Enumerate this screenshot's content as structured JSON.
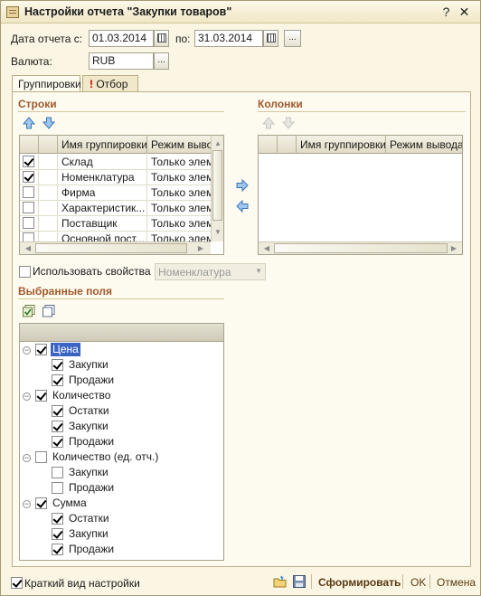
{
  "window": {
    "title": "Настройки отчета \"Закупки товаров\"",
    "help_glyph": "?",
    "close_glyph": "✕"
  },
  "header": {
    "date_label": "Дата отчета с:",
    "date_from": "01.03.2014",
    "to_label": "по:",
    "date_to": "31.03.2014",
    "period_button": "...",
    "currency_label": "Валюта:",
    "currency": "RUB",
    "currency_button": "..."
  },
  "tabs": [
    {
      "label": "Группировки",
      "active": true
    },
    {
      "label": "Отбор",
      "active": false
    }
  ],
  "rows_section": {
    "title": "Строки",
    "columns": [
      "Имя группировки",
      "Режим вывод"
    ],
    "rows": [
      {
        "checked": true,
        "name": "Склад",
        "mode": "Только элем"
      },
      {
        "checked": true,
        "name": "Номенклатура",
        "mode": "Только элем"
      },
      {
        "checked": false,
        "name": "Фирма",
        "mode": "Только элем"
      },
      {
        "checked": false,
        "name": "Характеристик...",
        "mode": "Только элем"
      },
      {
        "checked": false,
        "name": "Поставщик",
        "mode": "Только элем"
      },
      {
        "checked": false,
        "name": "Основной пост...",
        "mode": "Только элем"
      }
    ]
  },
  "columns_section": {
    "title": "Колонки",
    "columns": [
      "Имя группировки",
      "Режим вывода"
    ]
  },
  "use_properties": {
    "checked": false,
    "label": "Использовать свойства",
    "select_value": "Номенклатура"
  },
  "selected_fields": {
    "title": "Выбранные поля",
    "tree": [
      {
        "label": "Цена",
        "checked": true,
        "selected": true,
        "children": [
          {
            "label": "Закупки",
            "checked": true
          },
          {
            "label": "Продажи",
            "checked": true
          }
        ]
      },
      {
        "label": "Количество",
        "checked": true,
        "children": [
          {
            "label": "Остатки",
            "checked": true
          },
          {
            "label": "Закупки",
            "checked": true
          },
          {
            "label": "Продажи",
            "checked": true
          }
        ]
      },
      {
        "label": "Количество (ед. отч.)",
        "checked": false,
        "children": [
          {
            "label": "Закупки",
            "checked": false
          },
          {
            "label": "Продажи",
            "checked": false
          }
        ]
      },
      {
        "label": "Сумма",
        "checked": true,
        "children": [
          {
            "label": "Остатки",
            "checked": true
          },
          {
            "label": "Закупки",
            "checked": true
          },
          {
            "label": "Продажи",
            "checked": true
          }
        ]
      }
    ]
  },
  "footer": {
    "short_view_checked": true,
    "short_view_label": "Краткий вид настройки",
    "generate_button": "Сформировать",
    "ok_button": "OK",
    "cancel_button": "Отмена"
  },
  "icons": {
    "calendar": "calendar-icon",
    "move_up": "arrow-up-icon",
    "move_down": "arrow-down-icon",
    "move_right": "arrow-right-icon",
    "move_left": "arrow-left-icon",
    "check_all": "check-all-icon",
    "uncheck_all": "uncheck-all-icon",
    "open_settings": "folder-open-icon",
    "save_settings": "save-icon",
    "filter_warning": "exclamation-icon"
  },
  "colors": {
    "section_title": "#a15a2c",
    "selection": "#3b63c4",
    "window_bg": "#fbf6e3",
    "filter_mark": "#d00000"
  }
}
